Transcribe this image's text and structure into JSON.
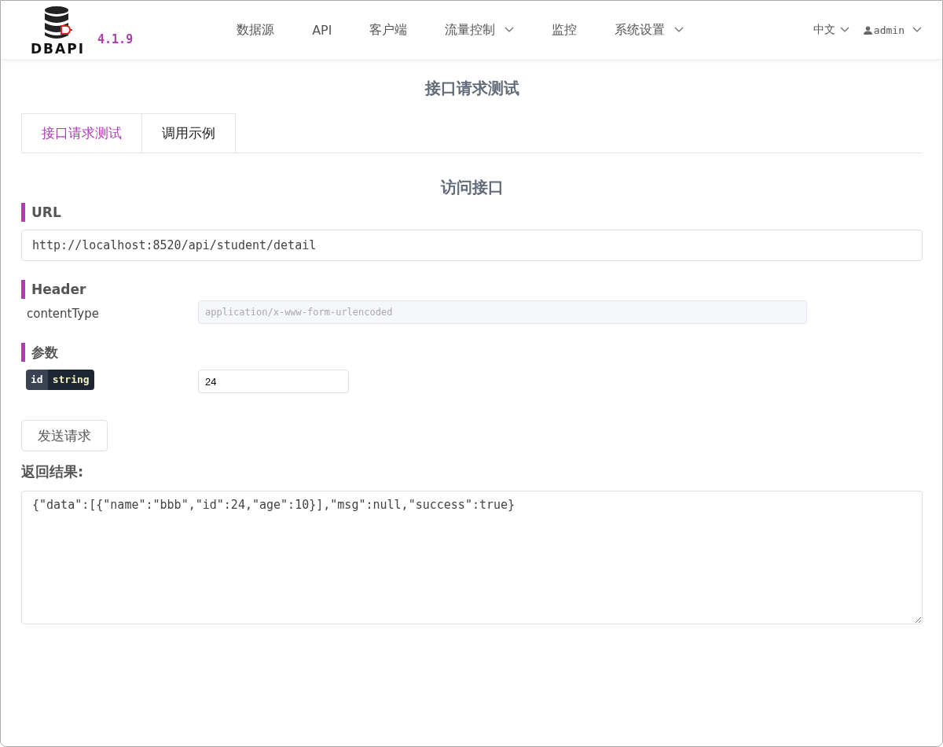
{
  "logo": {
    "name": "DBAPI",
    "version": "4.1.9"
  },
  "nav": [
    {
      "label": "数据源",
      "dropdown": false
    },
    {
      "label": "API",
      "dropdown": false
    },
    {
      "label": "客户端",
      "dropdown": false
    },
    {
      "label": "流量控制",
      "dropdown": true
    },
    {
      "label": "监控",
      "dropdown": false
    },
    {
      "label": "系统设置",
      "dropdown": true
    }
  ],
  "language": "中文",
  "user": "admin",
  "page_title": "接口请求测试",
  "tabs": [
    {
      "label": "接口请求测试",
      "selected": true
    },
    {
      "label": "调用示例",
      "selected": false
    }
  ],
  "section_title": "访问接口",
  "url": {
    "label": "URL",
    "value": "http://localhost:8520/api/student/detail"
  },
  "header": {
    "label": "Header",
    "rows": [
      {
        "name": "contentType",
        "value": "application/x-www-form-urlencoded",
        "disabled": true
      }
    ]
  },
  "params": {
    "label": "参数",
    "rows": [
      {
        "name": "id",
        "type": "string",
        "value": "24"
      }
    ]
  },
  "send_button": "发送请求",
  "result": {
    "label": "返回结果:",
    "value": "{\"data\":[{\"name\":\"bbb\",\"id\":24,\"age\":10}],\"msg\":null,\"success\":true}"
  }
}
